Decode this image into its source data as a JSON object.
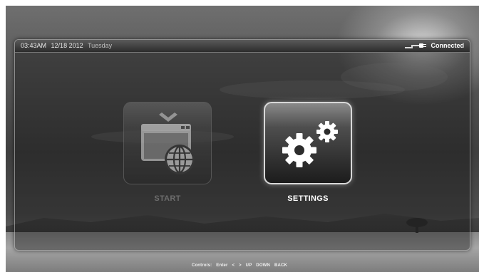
{
  "status_bar": {
    "time": "03:43AM",
    "date": "12/18 2012",
    "day": "Tuesday",
    "network_icon": "network-plug-icon",
    "connection_status": "Connected"
  },
  "menu": {
    "items": [
      {
        "label": "START",
        "icon": "window-globe-icon",
        "selected": false
      },
      {
        "label": "SETTINGS",
        "icon": "gears-icon",
        "selected": true
      }
    ]
  },
  "controls_hint": {
    "label": "Controls:",
    "enter": "Enter",
    "left": "<",
    "right": ">",
    "up": "UP",
    "down": "DOWN",
    "back": "BACK"
  },
  "colors": {
    "selected_label": "#ffffff",
    "unselected_label": "#6d6d6d",
    "selected_border": "#d8d8d8"
  }
}
